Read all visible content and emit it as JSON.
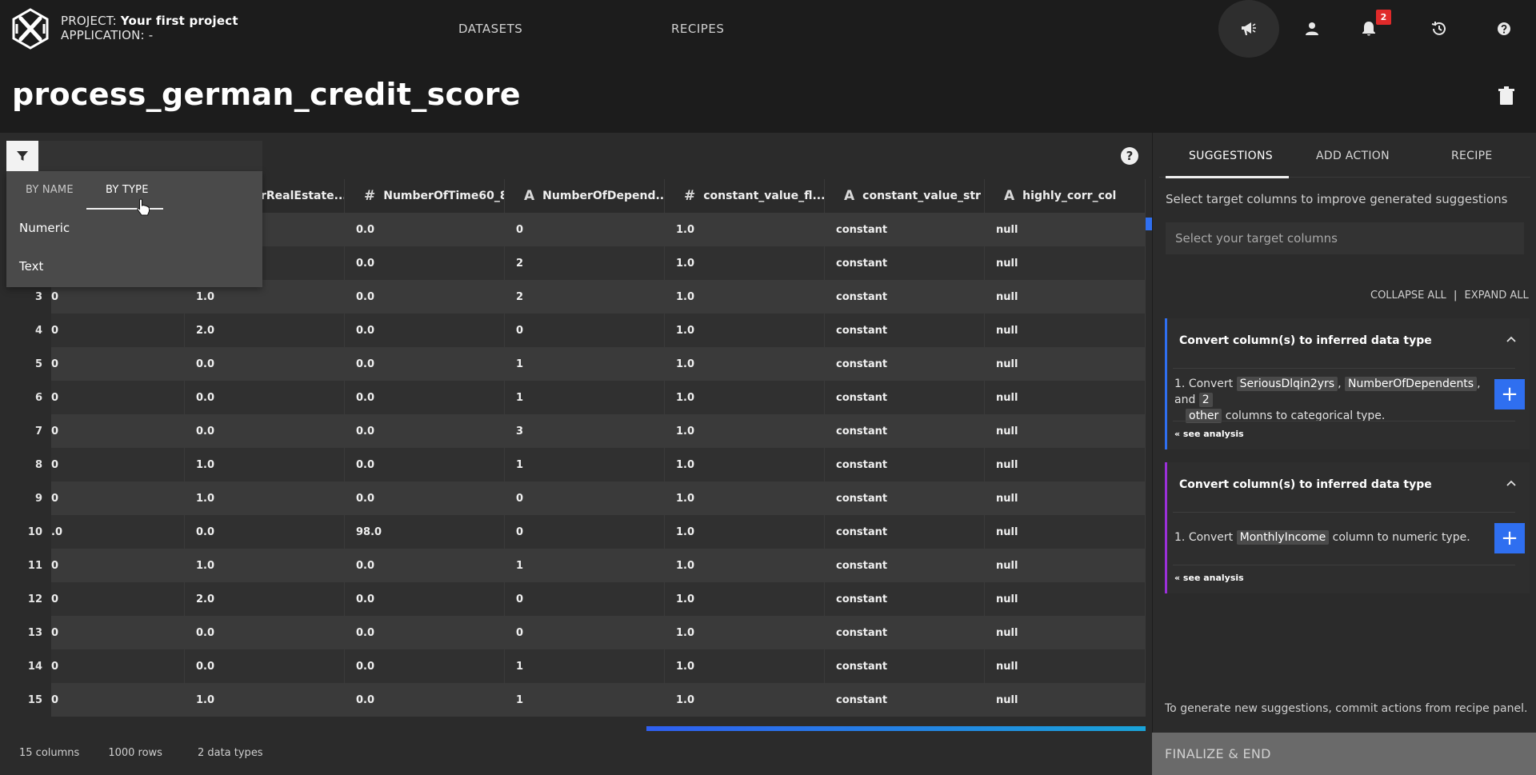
{
  "header": {
    "project_label": "PROJECT:",
    "project_name": "Your first project",
    "application_label": "APPLICATION:",
    "application_value": "-",
    "nav": [
      "DATASETS",
      "RECIPES"
    ],
    "notification_count": "2"
  },
  "page": {
    "title": "process_german_credit_score"
  },
  "grid": {
    "columns": [
      {
        "type": "",
        "name": ""
      },
      {
        "type": "",
        "name": "rRealEstate..."
      },
      {
        "type": "#",
        "name": "NumberOfTime60_8..."
      },
      {
        "type": "A",
        "name": "NumberOfDepend..."
      },
      {
        "type": "#",
        "name": "constant_value_fl..."
      },
      {
        "type": "A",
        "name": "constant_value_str"
      },
      {
        "type": "A",
        "name": "highly_corr_col"
      }
    ],
    "row_indexes": [
      "",
      "",
      "3",
      "4",
      "5",
      "6",
      "7",
      "8",
      "9",
      "10",
      "11",
      "12",
      "13",
      "14",
      "15"
    ],
    "rows": [
      [
        "",
        "",
        "0.0",
        "0",
        "1.0",
        "constant",
        "null"
      ],
      [
        "",
        "",
        "0.0",
        "2",
        "1.0",
        "constant",
        "null"
      ],
      [
        "0",
        "1.0",
        "0.0",
        "2",
        "1.0",
        "constant",
        "null"
      ],
      [
        "0",
        "2.0",
        "0.0",
        "0",
        "1.0",
        "constant",
        "null"
      ],
      [
        "0",
        "0.0",
        "0.0",
        "1",
        "1.0",
        "constant",
        "null"
      ],
      [
        "0",
        "0.0",
        "0.0",
        "1",
        "1.0",
        "constant",
        "null"
      ],
      [
        "0",
        "0.0",
        "0.0",
        "3",
        "1.0",
        "constant",
        "null"
      ],
      [
        "0",
        "1.0",
        "0.0",
        "1",
        "1.0",
        "constant",
        "null"
      ],
      [
        "0",
        "1.0",
        "0.0",
        "0",
        "1.0",
        "constant",
        "null"
      ],
      [
        ".0",
        "0.0",
        "98.0",
        "0",
        "1.0",
        "constant",
        "null"
      ],
      [
        "0",
        "1.0",
        "0.0",
        "1",
        "1.0",
        "constant",
        "null"
      ],
      [
        "0",
        "2.0",
        "0.0",
        "0",
        "1.0",
        "constant",
        "null"
      ],
      [
        "0",
        "0.0",
        "0.0",
        "0",
        "1.0",
        "constant",
        "null"
      ],
      [
        "0",
        "0.0",
        "0.0",
        "1",
        "1.0",
        "constant",
        "null"
      ],
      [
        "0",
        "1.0",
        "0.0",
        "1",
        "1.0",
        "constant",
        "null"
      ]
    ],
    "status": {
      "columns": "15 columns",
      "rows": "1000 rows",
      "types": "2 data types"
    }
  },
  "filter": {
    "tabs": [
      "BY NAME",
      "BY TYPE"
    ],
    "options": [
      "Numeric",
      "Text"
    ]
  },
  "right_panel": {
    "tabs": [
      "SUGGESTIONS",
      "ADD ACTION",
      "RECIPE"
    ],
    "target_hint": "Select target columns to improve generated suggestions",
    "target_placeholder": "Select your target columns",
    "collapse_all": "COLLAPSE ALL",
    "expand_all": "EXPAND ALL",
    "separator": "|",
    "suggestions": [
      {
        "title": "Convert column(s) to inferred data type",
        "accent": "#2f6ff0",
        "index": "1.",
        "text_prefix": "Convert",
        "chip1": "SeriousDlqin2yrs",
        "comma": ",",
        "chip2": "NumberOfDependents",
        "and_text": ", and",
        "chip3": "2",
        "chip4": "other",
        "text_suffix": "columns to categorical type.",
        "see_analysis": "« see analysis"
      },
      {
        "title": "Convert column(s) to inferred data type",
        "accent": "#9b30d9",
        "index": "1.",
        "text_prefix": "Convert",
        "chip1": "MonthlyIncome",
        "text_suffix": "column to numeric type.",
        "see_analysis": "« see analysis"
      }
    ],
    "generate_hint": "To generate new suggestions, commit actions from recipe panel.",
    "finalize_label": "FINALIZE & END"
  },
  "icons": [
    "logo-icon",
    "megaphone-icon",
    "user-icon",
    "bell-icon",
    "history-icon",
    "help-icon",
    "trash-icon",
    "filter-icon",
    "chevron-up-icon",
    "plus-icon",
    "cursor-icon"
  ]
}
